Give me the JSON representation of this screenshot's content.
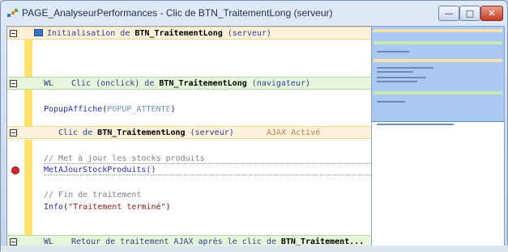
{
  "window": {
    "title": "PAGE_AnalyseurPerformances - Clic de BTN_TraitementLong (serveur)",
    "controls": {
      "minimize": "—",
      "maximize": "□",
      "close": "✕"
    }
  },
  "editor": {
    "section1": {
      "prefix": "Initialisation de ",
      "name": "BTN_TraitementLong",
      "suffix": " (serveur)"
    },
    "section2": {
      "tag": "WL",
      "prefix": "Clic (onclick) de ",
      "name": "BTN_TraitementLong",
      "suffix": " (navigateur)"
    },
    "line_popup": {
      "fn": "PopupAffiche",
      "open": "(",
      "arg": "POPUP_ATTENTE",
      "close": ")"
    },
    "section3": {
      "prefix": "Clic de ",
      "name": "BTN_TraitementLong",
      "suffix": " (serveur)",
      "ajax": "AJAX Activé"
    },
    "comment1": "// Met à jour les stocks produits",
    "line_stock": "MetAJourStockProduits()",
    "comment2": "// Fin de traitement",
    "line_info": {
      "fn": "Info",
      "open": "(",
      "arg": "\"Traitement terminé\"",
      "close": ")"
    },
    "section4": {
      "tag": "WL",
      "prefix": "Retour de traitement AJAX après le clic de ",
      "name": "BTN_Traitement..."
    }
  },
  "colors": {
    "green_header": "#e6f7dc",
    "orange_header": "#fdf1d9",
    "yellow_bar": "#fde36b",
    "breakpoint": "#d7262b",
    "minimap_view": "#a9c9f3"
  }
}
